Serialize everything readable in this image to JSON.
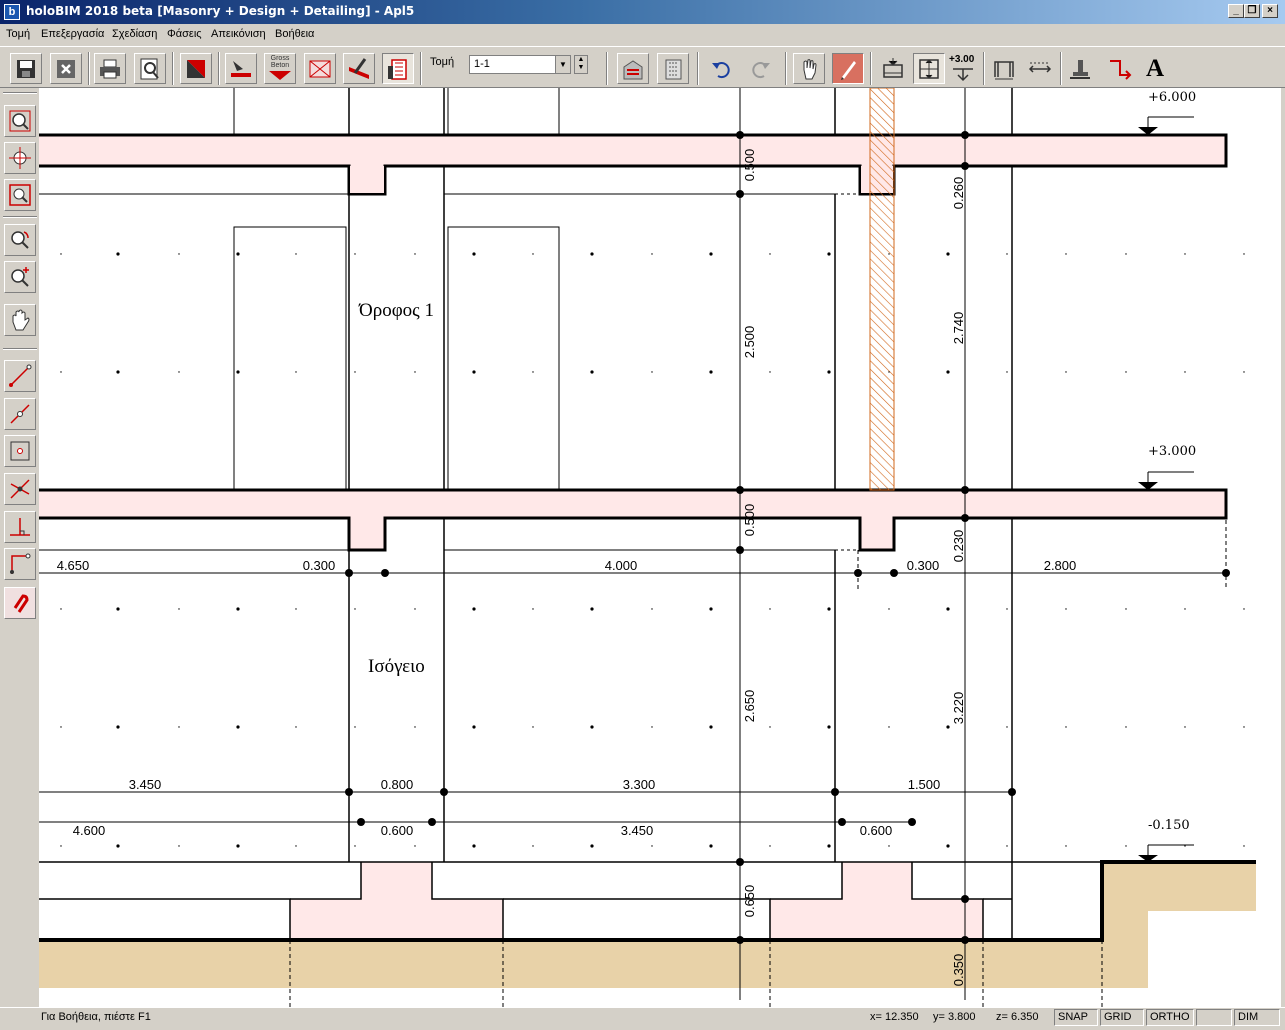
{
  "window": {
    "title": "holoBIM 2018 beta [Masonry + Design + Detailing] - Apl5",
    "app_icon_letter": "b"
  },
  "menu": [
    "Τομή",
    "Επεξεργασία",
    "Σχεδίαση",
    "Φάσεις",
    "Απεικόνιση",
    "Βοήθεια"
  ],
  "toolbar": {
    "section_label": "Τομή",
    "section_value": "1-1",
    "gross_beton_label": "Gross Beton",
    "elevation_button_label": "+3.00",
    "text_button_label": "A"
  },
  "drawing": {
    "floors": [
      {
        "label": "Όροφος 1",
        "level": "+6.000"
      },
      {
        "label": "Ισόγειο",
        "level": "+3.000"
      }
    ],
    "ground_level": "-0.150",
    "vertical_dims": [
      "0.500",
      "2.500",
      "0.500",
      "2.650",
      "0.650",
      "0.260",
      "2.740",
      "0.230",
      "3.220",
      "0.350"
    ],
    "dim_row1": [
      "4.650",
      "0.300",
      "4.000",
      "0.300",
      "2.800"
    ],
    "dim_row2": [
      "3.450",
      "0.800",
      "3.300",
      "1.500"
    ],
    "dim_row3": [
      "4.600",
      "0.600",
      "3.450",
      "0.600"
    ],
    "colors": {
      "slab_fill": "#ffe8e8",
      "soil_fill": "#e8d2a8",
      "hatch": "#d2691e"
    }
  },
  "status": {
    "help": "Για Βοήθεια, πιέστε F1",
    "x": "x= 12.350",
    "y": "y= 3.800",
    "z": "z= 6.350",
    "snap": "SNAP",
    "grid": "GRID",
    "ortho": "ORTHO",
    "dim": "DIM"
  }
}
